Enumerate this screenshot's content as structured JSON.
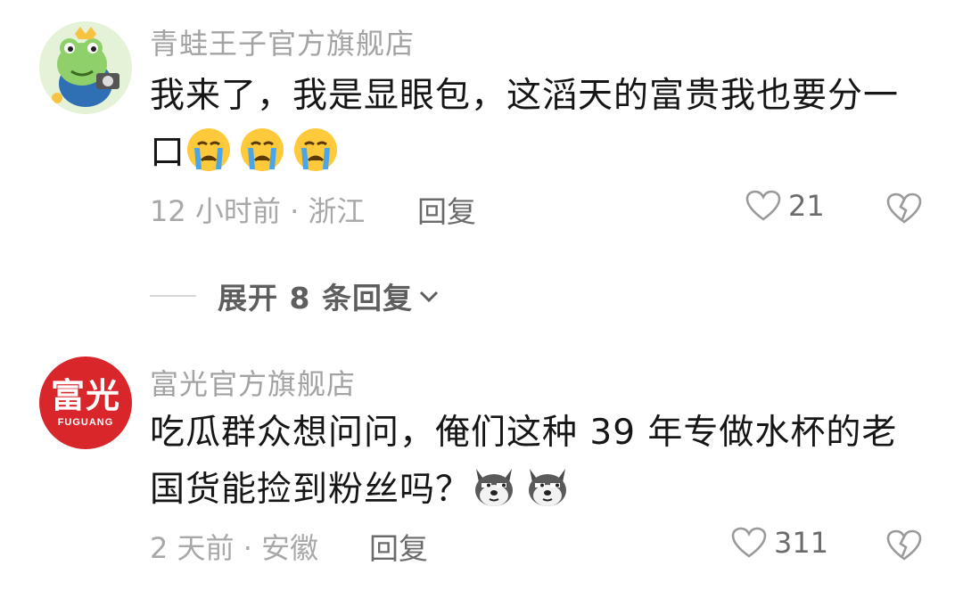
{
  "comments": [
    {
      "username": "青蛙王子官方旗舰店",
      "content": "我来了，我是显眼包，这滔天的富贵我也要分一口",
      "emojis": [
        "crying-face-emoji",
        "crying-face-emoji",
        "crying-face-emoji"
      ],
      "time": "12 小时前",
      "location": "浙江",
      "meta_separator": " · ",
      "reply_label": "回复",
      "likes": "21"
    },
    {
      "username": "富光官方旗舰店",
      "avatar_text": "富光",
      "avatar_subtext": "FUGUANG",
      "content": "吃瓜群众想问问，俺们这种 39 年专做水杯的老国货能捡到粉丝吗？",
      "emojis": [
        "doge-emoji",
        "doge-emoji"
      ],
      "time": "2 天前",
      "location": "安徽",
      "meta_separator": " · ",
      "reply_label": "回复",
      "likes": "311"
    }
  ],
  "expand_replies": {
    "label": "展开 8 条回复"
  },
  "colors": {
    "username": "#a3a3a3",
    "meta": "#a8a8a8",
    "content": "#161616",
    "fuguang_red": "#d8262b",
    "frog_green": "#8fd06a"
  }
}
